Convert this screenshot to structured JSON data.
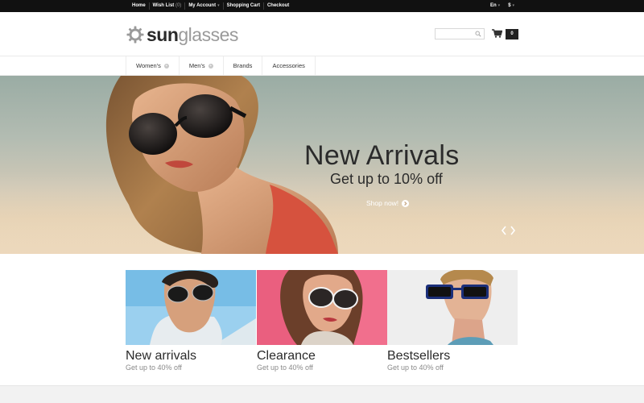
{
  "topbar": {
    "links": [
      "Home",
      "Wish List",
      "My Account",
      "Shopping Cart",
      "Checkout"
    ],
    "wishlist_count": "(0)",
    "language": "En",
    "currency": "$"
  },
  "header": {
    "logo_part1": "sun",
    "logo_part2": "glasses",
    "search_placeholder": "",
    "cart_count": "0"
  },
  "nav": {
    "items": [
      "Women's",
      "Men's",
      "Brands",
      "Accessories"
    ]
  },
  "hero": {
    "title": "New Arrivals",
    "subtitle": "Get up to 10% off",
    "cta": "Shop now!"
  },
  "banners": [
    {
      "title": "New arrivals",
      "subtitle": "Get up to 40% off"
    },
    {
      "title": "Clearance",
      "subtitle": "Get up to 40% off"
    },
    {
      "title": "Bestsellers",
      "subtitle": "Get up to 40% off"
    }
  ],
  "colors": {
    "topbar_bg": "#111111",
    "text_dark": "#2b2b2b",
    "text_muted": "#8a8a8a",
    "logo_gray": "#9a9a9a"
  },
  "icons": {
    "logo": "gear-icon",
    "search": "search-icon",
    "cart": "cart-icon",
    "cta": "chevron-right-circle-icon",
    "slider_prev": "chevron-left-icon",
    "slider_next": "chevron-right-icon",
    "nav_expand": "plus-icon"
  }
}
